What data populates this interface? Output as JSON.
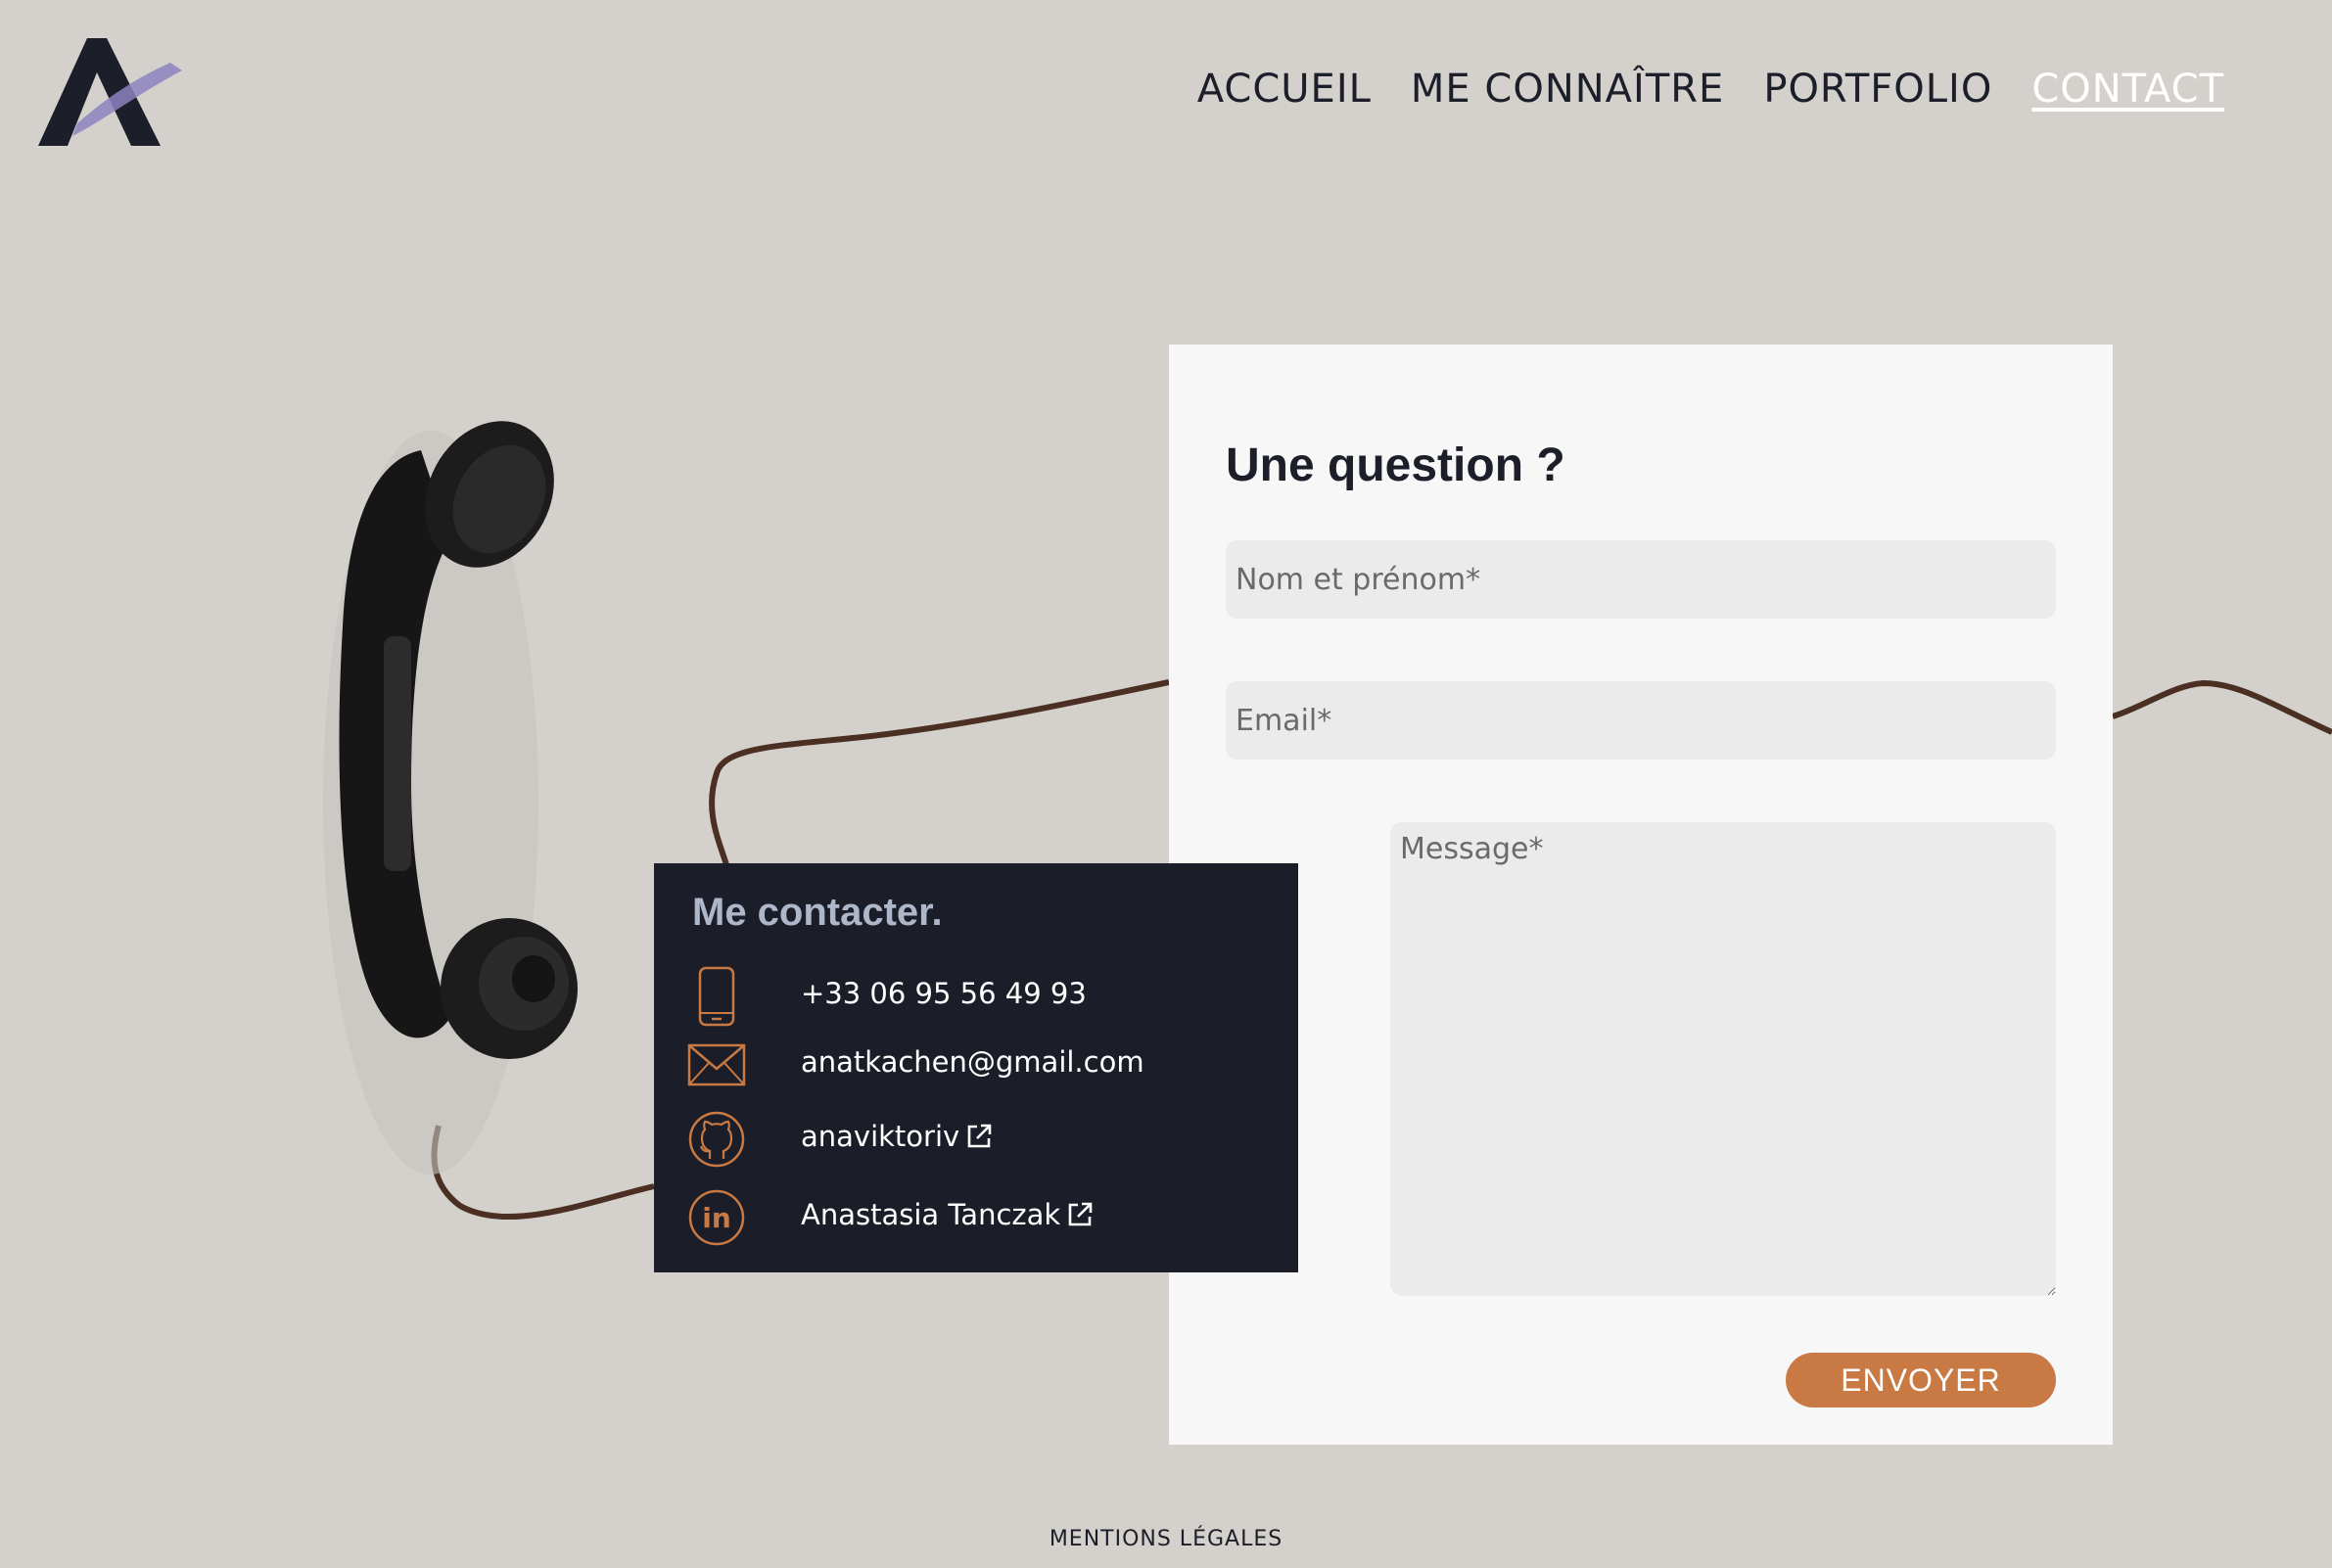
{
  "nav": {
    "items": [
      {
        "label": "ACCUEIL"
      },
      {
        "label": "ME CONNAÎTRE"
      },
      {
        "label": "PORTFOLIO"
      },
      {
        "label": "CONTACT"
      }
    ],
    "active": "CONTACT"
  },
  "form": {
    "title": "Une question ?",
    "name_placeholder": "Nom et prénom*",
    "email_placeholder": "Email*",
    "message_placeholder": "Message*",
    "submit_label": "ENVOYER"
  },
  "contact": {
    "title": "Me contacter.",
    "phone": "+33 06 95 56 49 93",
    "email": "anatkachen@gmail.com",
    "github": "anaviktoriv",
    "linkedin": "Anastasia Tanczak",
    "icons": [
      "phone-icon",
      "mail-icon",
      "github-icon",
      "linkedin-icon",
      "external-link-icon"
    ]
  },
  "footer": {
    "legal_label": "MENTIONS LÉGALES"
  },
  "colors": {
    "background": "#d4d1cc",
    "dark": "#1b1e28",
    "accent": "#c97a44",
    "card": "#f7f7f7",
    "field": "#ebebeb"
  }
}
